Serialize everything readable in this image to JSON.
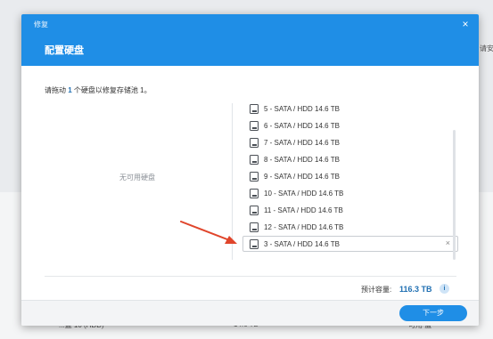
{
  "background": {
    "side_text": "请安",
    "rows": [
      "...盘 10 (HDD)",
      "14.6 TB",
      "可用 盘"
    ]
  },
  "dialog": {
    "small_title": "修复",
    "title": "配置硬盘",
    "close_label": "×",
    "instruction_prefix": "请拖动 ",
    "instruction_count": "1",
    "instruction_suffix": " 个硬盘以修复存储池 1。",
    "empty_label": "无可用硬盘",
    "disk_list": [
      "5 - SATA / HDD 14.6 TB",
      "6 - SATA / HDD 14.6 TB",
      "7 - SATA / HDD 14.6 TB",
      "8 - SATA / HDD 14.6 TB",
      "9 - SATA / HDD 14.6 TB",
      "10 - SATA / HDD 14.6 TB",
      "11 - SATA / HDD 14.6 TB",
      "12 - SATA / HDD 14.6 TB"
    ],
    "selected_disk": "3 - SATA / HDD 14.6 TB",
    "remove_label": "×",
    "capacity_label": "预计容量:",
    "capacity_value": "116.3 TB",
    "info_label": "i",
    "next_button": "下一步"
  },
  "colors": {
    "accent": "#1f8ee6",
    "annotation_arrow": "#e0452b"
  }
}
